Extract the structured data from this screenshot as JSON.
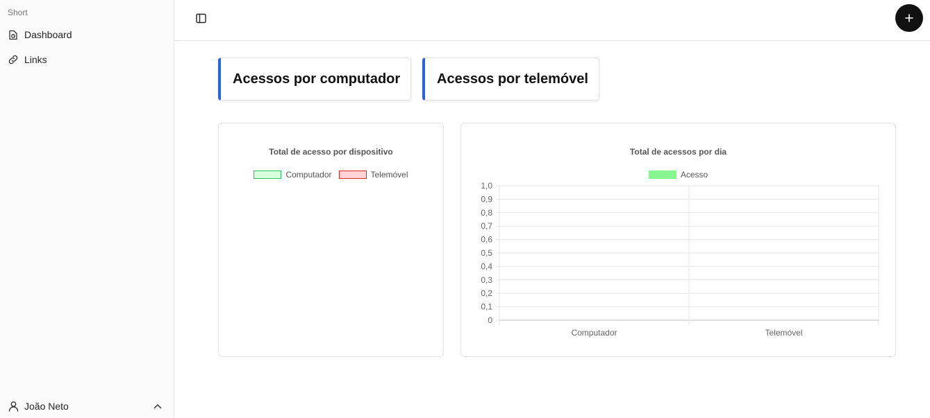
{
  "sidebar": {
    "brand": "Short",
    "items": [
      {
        "label": "Dashboard",
        "icon": "dashboard-icon"
      },
      {
        "label": "Links",
        "icon": "link-icon"
      }
    ],
    "user": {
      "name": "João Neto",
      "icon": "user-icon",
      "chevron": "chevron-up-icon"
    }
  },
  "header": {
    "toggle_icon": "sidebar-toggle-icon",
    "add_icon": "plus-icon"
  },
  "stats": {
    "computer_title": "Acessos por computador",
    "mobile_title": "Acessos por telemóvel",
    "accent_color": "#2563eb"
  },
  "chart_data": [
    {
      "type": "pie",
      "title": "Total de acesso por dispositivo",
      "categories": [
        "Computador",
        "Telemóvel"
      ],
      "values": [
        0,
        0
      ],
      "legend": [
        "Computador",
        "Telemóvel"
      ],
      "legend_position": "top",
      "colors": [
        "#22c55e",
        "#dc2626"
      ]
    },
    {
      "type": "bar",
      "title": "Total de acessos por dia",
      "categories": [
        "Computador",
        "Telemóvel"
      ],
      "series": [
        {
          "name": "Acesso",
          "values": [
            0,
            0
          ]
        }
      ],
      "ylim": [
        0,
        1
      ],
      "yticks": [
        "1,0",
        "0,9",
        "0,8",
        "0,7",
        "0,6",
        "0,5",
        "0,4",
        "0,3",
        "0,2",
        "0,1",
        "0"
      ],
      "grid": true,
      "legend_position": "top",
      "colors": [
        "#86f58f"
      ]
    }
  ]
}
